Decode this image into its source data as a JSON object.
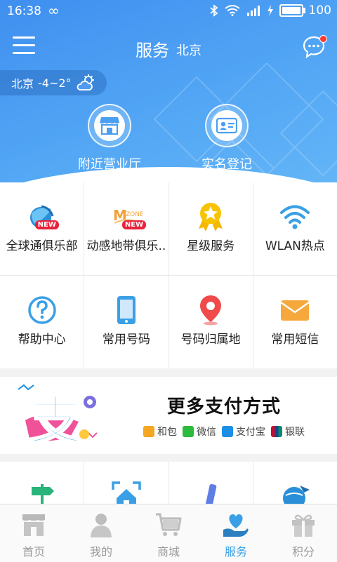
{
  "statusbar": {
    "time": "16:38",
    "battery": "100",
    "battery_level": 1.0
  },
  "header": {
    "title": "服务",
    "city": "北京"
  },
  "weather": {
    "city": "北京",
    "temp": "-4~2°"
  },
  "hero_buttons": [
    {
      "label": "附近营业厅",
      "icon": "store-icon"
    },
    {
      "label": "实名登记",
      "icon": "id-card-icon"
    }
  ],
  "services": [
    {
      "label": "全球通俱乐部",
      "icon": "globe-club-icon",
      "badge": "NEW"
    },
    {
      "label": "动感地带俱乐..",
      "icon": "mzone-icon",
      "badge": "NEW"
    },
    {
      "label": "星级服务",
      "icon": "star-medal-icon",
      "badge": ""
    },
    {
      "label": "WLAN热点",
      "icon": "wifi-icon",
      "badge": ""
    },
    {
      "label": "帮助中心",
      "icon": "help-icon",
      "badge": ""
    },
    {
      "label": "常用号码",
      "icon": "phone-icon",
      "badge": ""
    },
    {
      "label": "号码归属地",
      "icon": "location-pin-icon",
      "badge": ""
    },
    {
      "label": "常用短信",
      "icon": "mail-icon",
      "badge": ""
    }
  ],
  "banner": {
    "title": "更多支付方式",
    "methods": [
      {
        "label": "和包",
        "color": "#f5a623"
      },
      {
        "label": "微信",
        "color": "#2dbb3d"
      },
      {
        "label": "支付宝",
        "color": "#1a8fe3"
      },
      {
        "label": "银联",
        "color": "#c8102e"
      }
    ]
  },
  "services_row3": [
    {
      "icon": "signpost-icon"
    },
    {
      "icon": "home-scan-icon"
    },
    {
      "icon": "pencil-icon"
    },
    {
      "icon": "globe-plane-icon"
    }
  ],
  "tabs": [
    {
      "label": "首页",
      "icon": "home-icon",
      "active": false
    },
    {
      "label": "我的",
      "icon": "user-icon",
      "active": false
    },
    {
      "label": "商城",
      "icon": "cart-icon",
      "active": false
    },
    {
      "label": "服务",
      "icon": "heart-hand-icon",
      "active": true
    },
    {
      "label": "积分",
      "icon": "gift-icon",
      "active": false
    }
  ],
  "colors": {
    "accent": "#3aa0e6",
    "hero": "#4a9cf2"
  }
}
